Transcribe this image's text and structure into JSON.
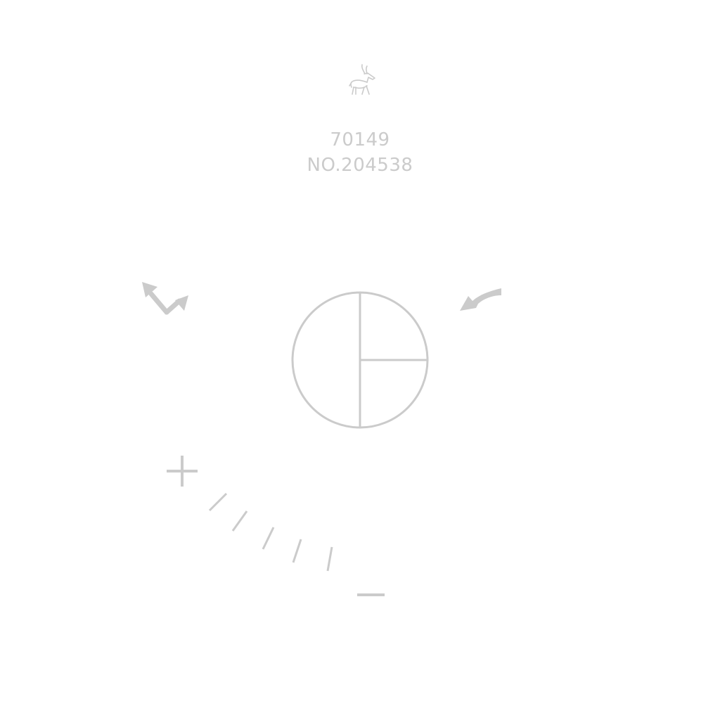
{
  "colors": {
    "background": "#ffffff",
    "ink": "#cbcbcb"
  },
  "logo": {
    "icon": "gazelle-icon"
  },
  "codes": {
    "model": "70149",
    "serial": "NO.204538"
  },
  "icons": {
    "rotate_left": "double-arrow-v-icon",
    "rotate_right": "curved-arrow-left-icon",
    "dial": "quartered-circle-icon",
    "plus": "plus-icon",
    "minus": "minus-icon"
  },
  "scale": {
    "tick_count": 5
  }
}
